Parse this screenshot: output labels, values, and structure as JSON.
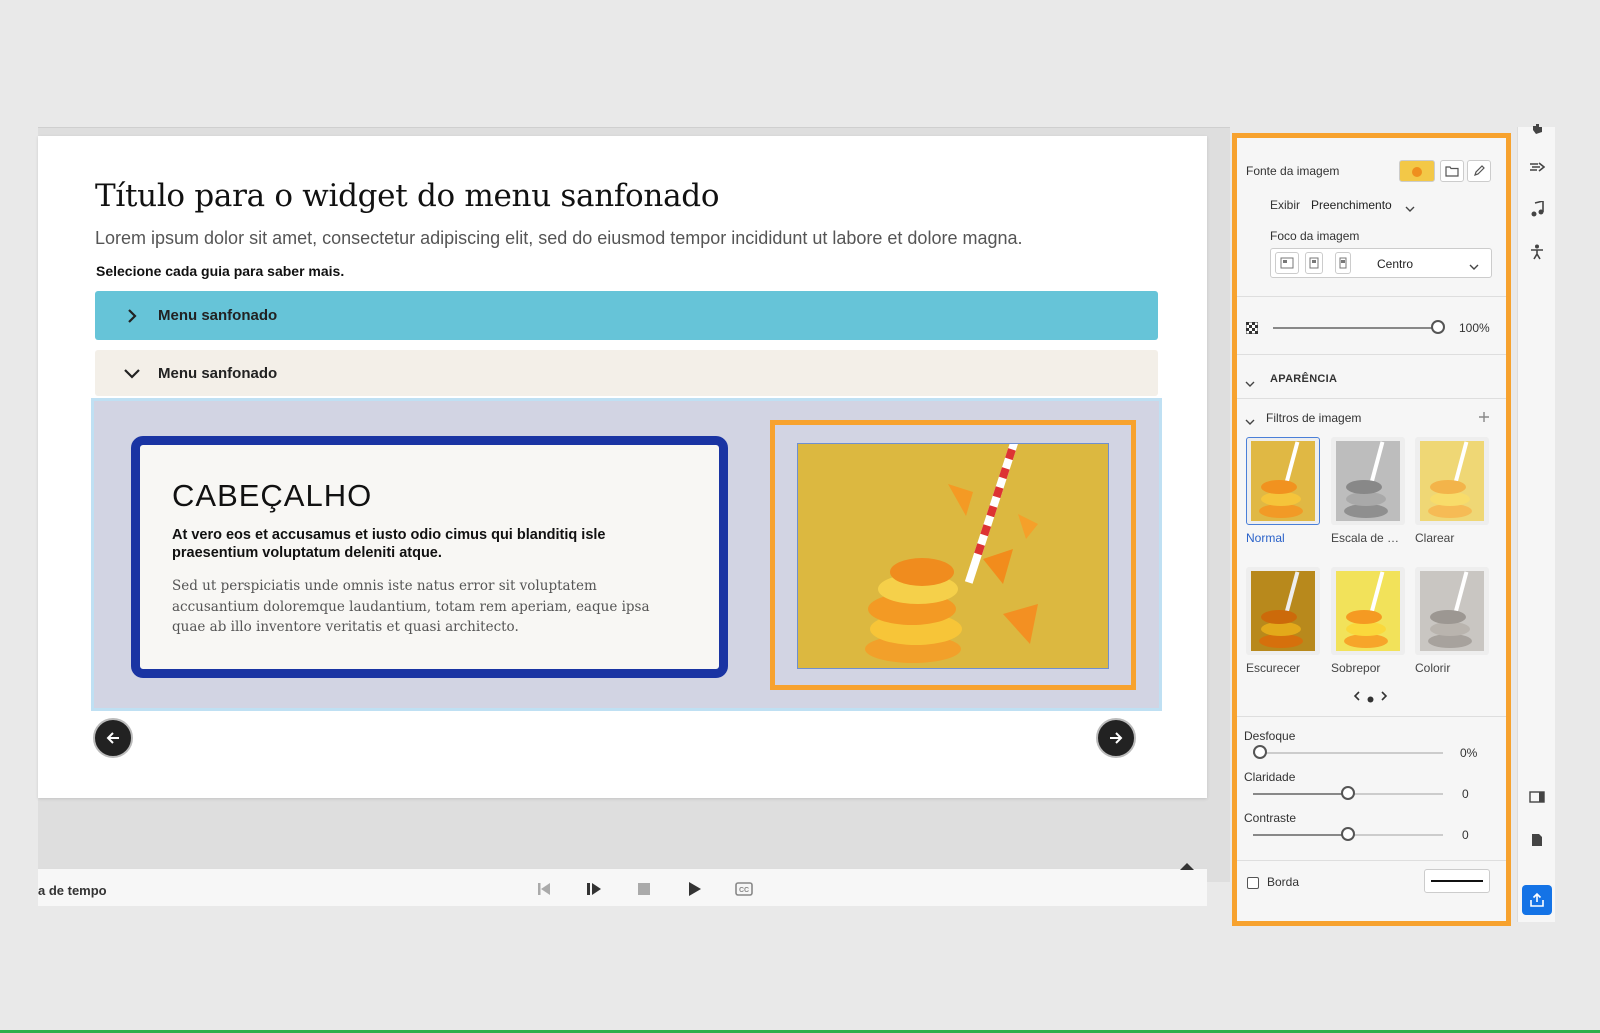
{
  "slide": {
    "title": "Título para o widget do menu sanfonado",
    "subtitle": "Lorem ipsum dolor sit amet, consectetur adipiscing elit, sed do eiusmod tempor incididunt ut labore et dolore magna.",
    "instruction": "Selecione cada guia para saber mais.",
    "accordion": [
      {
        "label": "Menu sanfonado",
        "state": "collapsed"
      },
      {
        "label": "Menu sanfonado",
        "state": "expanded"
      }
    ],
    "card": {
      "heading": "CABEÇALHO",
      "bold": "At vero eos et accusamus et iusto odio cimus qui blanditiq isle praesentium voluptatum deleniti atque.",
      "body": "Sed ut perspiciatis unde omnis iste natus error sit voluptatem accusantium doloremque laudantium, totam rem aperiam, eaque ipsa quae ab illo inventore veritatis et quasi architecto."
    }
  },
  "timeline": {
    "label": "a de tempo"
  },
  "properties": {
    "image_source_label": "Fonte da imagem",
    "display_label": "Exibir",
    "display_value": "Preenchimento",
    "focus_label": "Foco da imagem",
    "focus_value": "Centro",
    "opacity_value": "100%",
    "appearance_label": "APARÊNCIA",
    "filters_label": "Filtros de imagem",
    "filters": [
      {
        "name": "Normal",
        "selected": true
      },
      {
        "name": "Escala de ci...",
        "selected": false
      },
      {
        "name": "Clarear",
        "selected": false
      },
      {
        "name": "Escurecer",
        "selected": false
      },
      {
        "name": "Sobrepor",
        "selected": false
      },
      {
        "name": "Colorir",
        "selected": false
      }
    ],
    "blur_label": "Desfoque",
    "blur_value": "0%",
    "brightness_label": "Claridade",
    "brightness_value": "0",
    "contrast_label": "Contraste",
    "contrast_value": "0",
    "border_label": "Borda"
  },
  "colors": {
    "accent_orange": "#f7a22e",
    "accordion_teal": "#66c4d8",
    "card_border": "#1a34a3",
    "selected_blue": "#1473e6"
  }
}
